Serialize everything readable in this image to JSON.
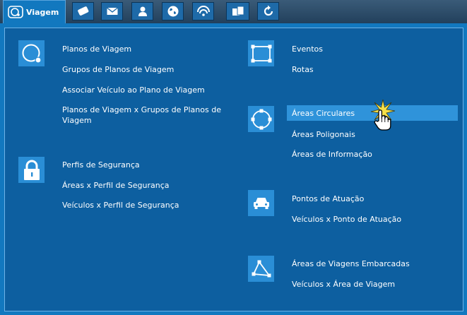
{
  "tabs": {
    "viagem_label": "Viagem",
    "icons": [
      "route-icon",
      "card-icon",
      "mail-icon",
      "person-icon",
      "globe-icon",
      "signal-icon",
      "devices-icon",
      "refresh-icon"
    ]
  },
  "colors": {
    "panel": "#1278bf",
    "inner": "#0d5fa0",
    "icon_box": "#2a8ed6",
    "highlight": "#2f93da"
  },
  "left": {
    "group1": [
      "Planos de Viagem",
      "Grupos de Planos de Viagem",
      "Associar Veículo ao Plano de Viagem",
      "Planos de Viagem x Grupos de Planos de Viagem"
    ],
    "group2": [
      "Perfis de Segurança",
      "Áreas x Perfil de Segurança",
      "Veículos x Perfil de Segurança"
    ]
  },
  "right": {
    "group1": [
      "Eventos",
      "Rotas"
    ],
    "group2": [
      "Áreas Circulares",
      "Áreas Poligonais",
      "Áreas de Informação"
    ],
    "group3": [
      "Pontos de Atuação",
      "Veículos x Ponto de Atuação"
    ],
    "group4": [
      "Áreas de Viagens Embarcadas",
      "Veículos x Área de Viagem"
    ]
  },
  "selected": "Áreas Circulares"
}
